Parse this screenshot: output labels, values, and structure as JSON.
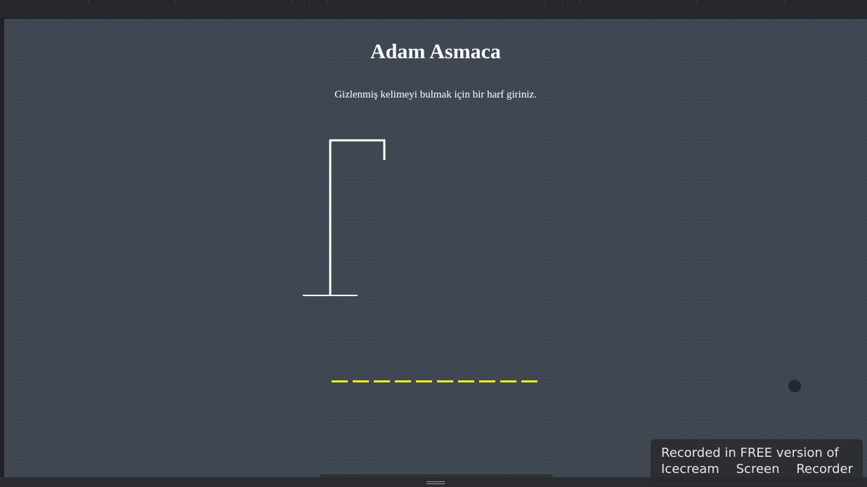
{
  "game": {
    "title": "Adam Asmaca",
    "instruction": "Gizlenmiş kelimeyi bulmak için bir harf giriniz.",
    "word_length": 10,
    "slot_color": "#f7f200",
    "background_color": "#3d4650"
  },
  "watermark": {
    "line1": "Recorded in FREE version of",
    "line2_words": [
      "Icecream",
      "Screen",
      "Recorder"
    ]
  },
  "icons": {
    "gallows": "gallows-drawing",
    "grip": "grip-lines-icon"
  }
}
